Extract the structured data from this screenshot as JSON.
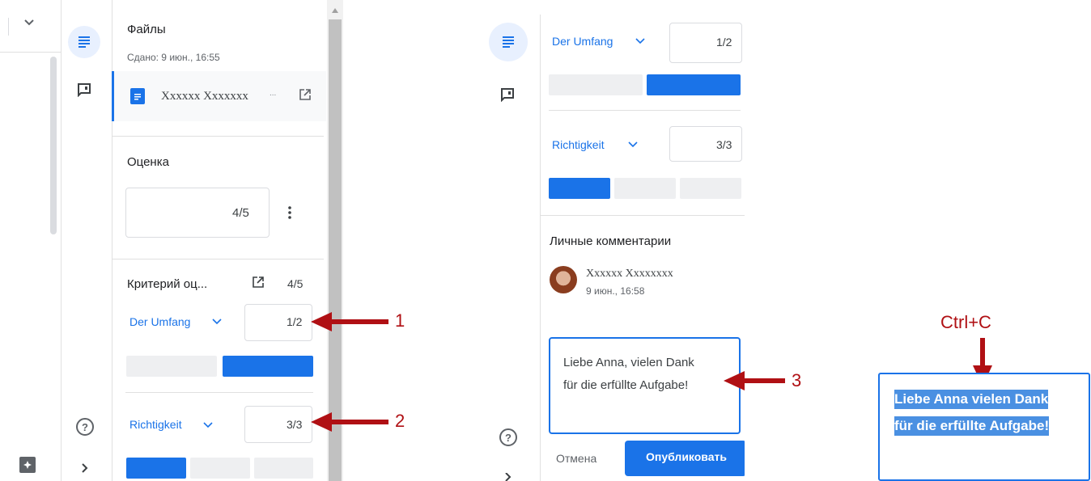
{
  "left": {
    "files_title": "Файлы",
    "submitted": "Сдано: 9 июн., 16:55",
    "file_name": "Xxxxxx Xxxxxxx",
    "file_ellipsis": "...",
    "grade_title": "Оценка",
    "grade_value": "4/5",
    "rubric_title": "Критерий оц...",
    "rubric_total": "4/5",
    "criteria": [
      {
        "name": "Der Umfang",
        "score": "1/2"
      },
      {
        "name": "Richtigkeit",
        "score": "3/3"
      }
    ]
  },
  "middle": {
    "criteria": [
      {
        "name": "Der Umfang",
        "score": "1/2"
      },
      {
        "name": "Richtigkeit",
        "score": "3/3"
      }
    ],
    "comments_title": "Личные комментарии",
    "comment_author": "Xxxxxx Xxxxxxxx",
    "comment_time": "9 июн., 16:58",
    "comment_text_line1": "Liebe Anna, vielen Dank",
    "comment_text_line2": "für die erfüllte Aufgabe!",
    "cancel_label": "Отмена",
    "publish_label": "Опубликовать"
  },
  "right": {
    "hint": "Ctrl+C",
    "selected_line1": "Liebe Anna vielen Dank",
    "selected_line2": "für die erfüllte Aufgabe!"
  },
  "annotations": {
    "n1": "1",
    "n2": "2",
    "n3": "3"
  },
  "colors": {
    "accent": "#1a73e8",
    "arrow": "#b01014",
    "selection": "#4a90e2"
  },
  "icons": [
    "chevron-down-icon",
    "assignment-list-icon",
    "comment-icon",
    "open-in-new-icon",
    "more-vert-icon",
    "help-icon",
    "chevron-right-icon",
    "feedback-icon",
    "doc-icon"
  ]
}
